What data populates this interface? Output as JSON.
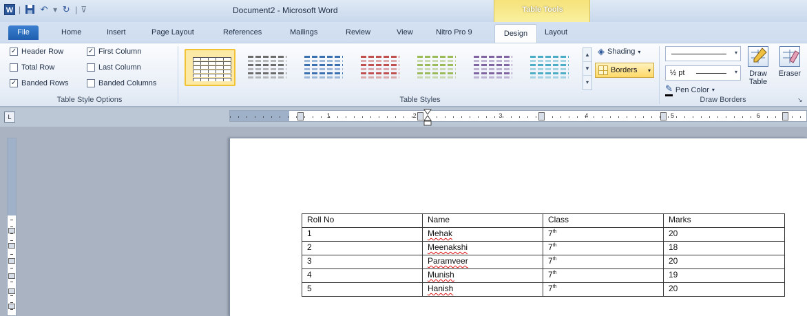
{
  "titlebar": {
    "app_icon": "W",
    "title": "Document2 - Microsoft Word",
    "contextual_group": "Table Tools",
    "qat": [
      "save-icon",
      "undo-icon",
      "redo-icon",
      "customize-icon"
    ]
  },
  "tabs": {
    "file": "File",
    "home": "Home",
    "insert": "Insert",
    "page_layout": "Page Layout",
    "references": "References",
    "mailings": "Mailings",
    "review": "Review",
    "view": "View",
    "nitro": "Nitro Pro 9",
    "design": "Design",
    "layout": "Layout"
  },
  "table_style_options": {
    "label": "Table Style Options",
    "header_row": {
      "label": "Header Row",
      "checked": true
    },
    "total_row": {
      "label": "Total Row",
      "checked": false
    },
    "banded_rows": {
      "label": "Banded Rows",
      "checked": true
    },
    "first_column": {
      "label": "First Column",
      "checked": true
    },
    "last_column": {
      "label": "Last Column",
      "checked": false
    },
    "banded_columns": {
      "label": "Banded Columns",
      "checked": false
    }
  },
  "table_styles": {
    "label": "Table Styles",
    "shading": "Shading",
    "borders": "Borders",
    "accent_colors": [
      "#4a4a4a",
      "#6b6b6b",
      "#3a6fb0",
      "#c0504d",
      "#9bbb59",
      "#8064a2",
      "#4bacc6"
    ]
  },
  "draw_borders": {
    "label": "Draw Borders",
    "weight": "½ pt",
    "pen_color": "Pen Color",
    "draw_table": "Draw Table",
    "eraser": "Eraser"
  },
  "ruler": {
    "numbers": [
      "1",
      "2",
      "3",
      "4",
      "5",
      "6"
    ]
  },
  "document_table": {
    "headers": [
      "Roll No",
      "Name",
      "Class",
      "Marks"
    ],
    "rows": [
      {
        "roll": "1",
        "name": "Mehak",
        "class": "7",
        "sup": "th",
        "marks": "20"
      },
      {
        "roll": "2",
        "name": "Meenakshi",
        "class": "7",
        "sup": "th",
        "marks": "18"
      },
      {
        "roll": "3",
        "name": "Paramveer",
        "class": "7",
        "sup": "th",
        "marks": "20"
      },
      {
        "roll": "4",
        "name": "Munish",
        "class": "7",
        "sup": "th",
        "marks": "19"
      },
      {
        "roll": "5",
        "name": "Hanish",
        "class": "7",
        "sup": "th",
        "marks": "20"
      }
    ]
  }
}
